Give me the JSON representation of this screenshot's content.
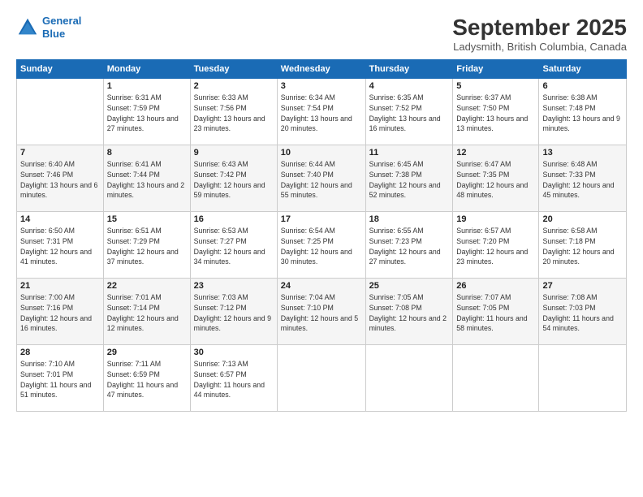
{
  "header": {
    "logo_line1": "General",
    "logo_line2": "Blue",
    "month": "September 2025",
    "location": "Ladysmith, British Columbia, Canada"
  },
  "weekdays": [
    "Sunday",
    "Monday",
    "Tuesday",
    "Wednesday",
    "Thursday",
    "Friday",
    "Saturday"
  ],
  "weeks": [
    [
      {
        "day": "",
        "sunrise": "",
        "sunset": "",
        "daylight": ""
      },
      {
        "day": "1",
        "sunrise": "Sunrise: 6:31 AM",
        "sunset": "Sunset: 7:59 PM",
        "daylight": "Daylight: 13 hours and 27 minutes."
      },
      {
        "day": "2",
        "sunrise": "Sunrise: 6:33 AM",
        "sunset": "Sunset: 7:56 PM",
        "daylight": "Daylight: 13 hours and 23 minutes."
      },
      {
        "day": "3",
        "sunrise": "Sunrise: 6:34 AM",
        "sunset": "Sunset: 7:54 PM",
        "daylight": "Daylight: 13 hours and 20 minutes."
      },
      {
        "day": "4",
        "sunrise": "Sunrise: 6:35 AM",
        "sunset": "Sunset: 7:52 PM",
        "daylight": "Daylight: 13 hours and 16 minutes."
      },
      {
        "day": "5",
        "sunrise": "Sunrise: 6:37 AM",
        "sunset": "Sunset: 7:50 PM",
        "daylight": "Daylight: 13 hours and 13 minutes."
      },
      {
        "day": "6",
        "sunrise": "Sunrise: 6:38 AM",
        "sunset": "Sunset: 7:48 PM",
        "daylight": "Daylight: 13 hours and 9 minutes."
      }
    ],
    [
      {
        "day": "7",
        "sunrise": "Sunrise: 6:40 AM",
        "sunset": "Sunset: 7:46 PM",
        "daylight": "Daylight: 13 hours and 6 minutes."
      },
      {
        "day": "8",
        "sunrise": "Sunrise: 6:41 AM",
        "sunset": "Sunset: 7:44 PM",
        "daylight": "Daylight: 13 hours and 2 minutes."
      },
      {
        "day": "9",
        "sunrise": "Sunrise: 6:43 AM",
        "sunset": "Sunset: 7:42 PM",
        "daylight": "Daylight: 12 hours and 59 minutes."
      },
      {
        "day": "10",
        "sunrise": "Sunrise: 6:44 AM",
        "sunset": "Sunset: 7:40 PM",
        "daylight": "Daylight: 12 hours and 55 minutes."
      },
      {
        "day": "11",
        "sunrise": "Sunrise: 6:45 AM",
        "sunset": "Sunset: 7:38 PM",
        "daylight": "Daylight: 12 hours and 52 minutes."
      },
      {
        "day": "12",
        "sunrise": "Sunrise: 6:47 AM",
        "sunset": "Sunset: 7:35 PM",
        "daylight": "Daylight: 12 hours and 48 minutes."
      },
      {
        "day": "13",
        "sunrise": "Sunrise: 6:48 AM",
        "sunset": "Sunset: 7:33 PM",
        "daylight": "Daylight: 12 hours and 45 minutes."
      }
    ],
    [
      {
        "day": "14",
        "sunrise": "Sunrise: 6:50 AM",
        "sunset": "Sunset: 7:31 PM",
        "daylight": "Daylight: 12 hours and 41 minutes."
      },
      {
        "day": "15",
        "sunrise": "Sunrise: 6:51 AM",
        "sunset": "Sunset: 7:29 PM",
        "daylight": "Daylight: 12 hours and 37 minutes."
      },
      {
        "day": "16",
        "sunrise": "Sunrise: 6:53 AM",
        "sunset": "Sunset: 7:27 PM",
        "daylight": "Daylight: 12 hours and 34 minutes."
      },
      {
        "day": "17",
        "sunrise": "Sunrise: 6:54 AM",
        "sunset": "Sunset: 7:25 PM",
        "daylight": "Daylight: 12 hours and 30 minutes."
      },
      {
        "day": "18",
        "sunrise": "Sunrise: 6:55 AM",
        "sunset": "Sunset: 7:23 PM",
        "daylight": "Daylight: 12 hours and 27 minutes."
      },
      {
        "day": "19",
        "sunrise": "Sunrise: 6:57 AM",
        "sunset": "Sunset: 7:20 PM",
        "daylight": "Daylight: 12 hours and 23 minutes."
      },
      {
        "day": "20",
        "sunrise": "Sunrise: 6:58 AM",
        "sunset": "Sunset: 7:18 PM",
        "daylight": "Daylight: 12 hours and 20 minutes."
      }
    ],
    [
      {
        "day": "21",
        "sunrise": "Sunrise: 7:00 AM",
        "sunset": "Sunset: 7:16 PM",
        "daylight": "Daylight: 12 hours and 16 minutes."
      },
      {
        "day": "22",
        "sunrise": "Sunrise: 7:01 AM",
        "sunset": "Sunset: 7:14 PM",
        "daylight": "Daylight: 12 hours and 12 minutes."
      },
      {
        "day": "23",
        "sunrise": "Sunrise: 7:03 AM",
        "sunset": "Sunset: 7:12 PM",
        "daylight": "Daylight: 12 hours and 9 minutes."
      },
      {
        "day": "24",
        "sunrise": "Sunrise: 7:04 AM",
        "sunset": "Sunset: 7:10 PM",
        "daylight": "Daylight: 12 hours and 5 minutes."
      },
      {
        "day": "25",
        "sunrise": "Sunrise: 7:05 AM",
        "sunset": "Sunset: 7:08 PM",
        "daylight": "Daylight: 12 hours and 2 minutes."
      },
      {
        "day": "26",
        "sunrise": "Sunrise: 7:07 AM",
        "sunset": "Sunset: 7:05 PM",
        "daylight": "Daylight: 11 hours and 58 minutes."
      },
      {
        "day": "27",
        "sunrise": "Sunrise: 7:08 AM",
        "sunset": "Sunset: 7:03 PM",
        "daylight": "Daylight: 11 hours and 54 minutes."
      }
    ],
    [
      {
        "day": "28",
        "sunrise": "Sunrise: 7:10 AM",
        "sunset": "Sunset: 7:01 PM",
        "daylight": "Daylight: 11 hours and 51 minutes."
      },
      {
        "day": "29",
        "sunrise": "Sunrise: 7:11 AM",
        "sunset": "Sunset: 6:59 PM",
        "daylight": "Daylight: 11 hours and 47 minutes."
      },
      {
        "day": "30",
        "sunrise": "Sunrise: 7:13 AM",
        "sunset": "Sunset: 6:57 PM",
        "daylight": "Daylight: 11 hours and 44 minutes."
      },
      {
        "day": "",
        "sunrise": "",
        "sunset": "",
        "daylight": ""
      },
      {
        "day": "",
        "sunrise": "",
        "sunset": "",
        "daylight": ""
      },
      {
        "day": "",
        "sunrise": "",
        "sunset": "",
        "daylight": ""
      },
      {
        "day": "",
        "sunrise": "",
        "sunset": "",
        "daylight": ""
      }
    ]
  ]
}
